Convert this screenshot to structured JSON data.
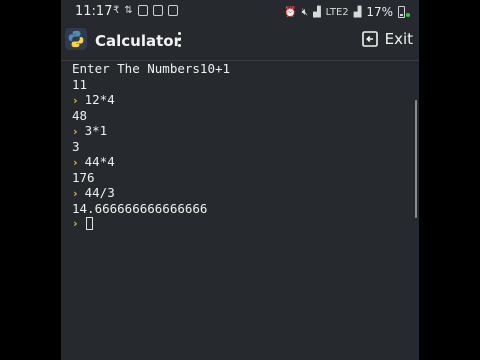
{
  "status_bar": {
    "time": "11:17",
    "battery": "17%",
    "network_label": "LTE2",
    "left_icons": [
      "rupee-icon",
      "data-icon",
      "gallery-icon",
      "gallery-icon",
      "gallery-icon"
    ],
    "right_icons": [
      "alarm-icon",
      "mute-icon",
      "signal-icon",
      "volte-icon",
      "signal-icon"
    ]
  },
  "app_bar": {
    "title": "Calculator",
    "exit_label": "Exit",
    "accent_color": "#e8c34a"
  },
  "console": {
    "lines": [
      {
        "type": "output",
        "text": "Enter The Numbers10+1"
      },
      {
        "type": "output",
        "text": "11"
      },
      {
        "type": "input",
        "text": "12*4"
      },
      {
        "type": "output",
        "text": "48"
      },
      {
        "type": "input",
        "text": "3*1"
      },
      {
        "type": "output",
        "text": "3"
      },
      {
        "type": "input",
        "text": "44*4"
      },
      {
        "type": "output",
        "text": "176"
      },
      {
        "type": "input",
        "text": "44/3"
      },
      {
        "type": "output",
        "text": "14.666666666666666"
      }
    ],
    "prompt_symbol": "›"
  }
}
